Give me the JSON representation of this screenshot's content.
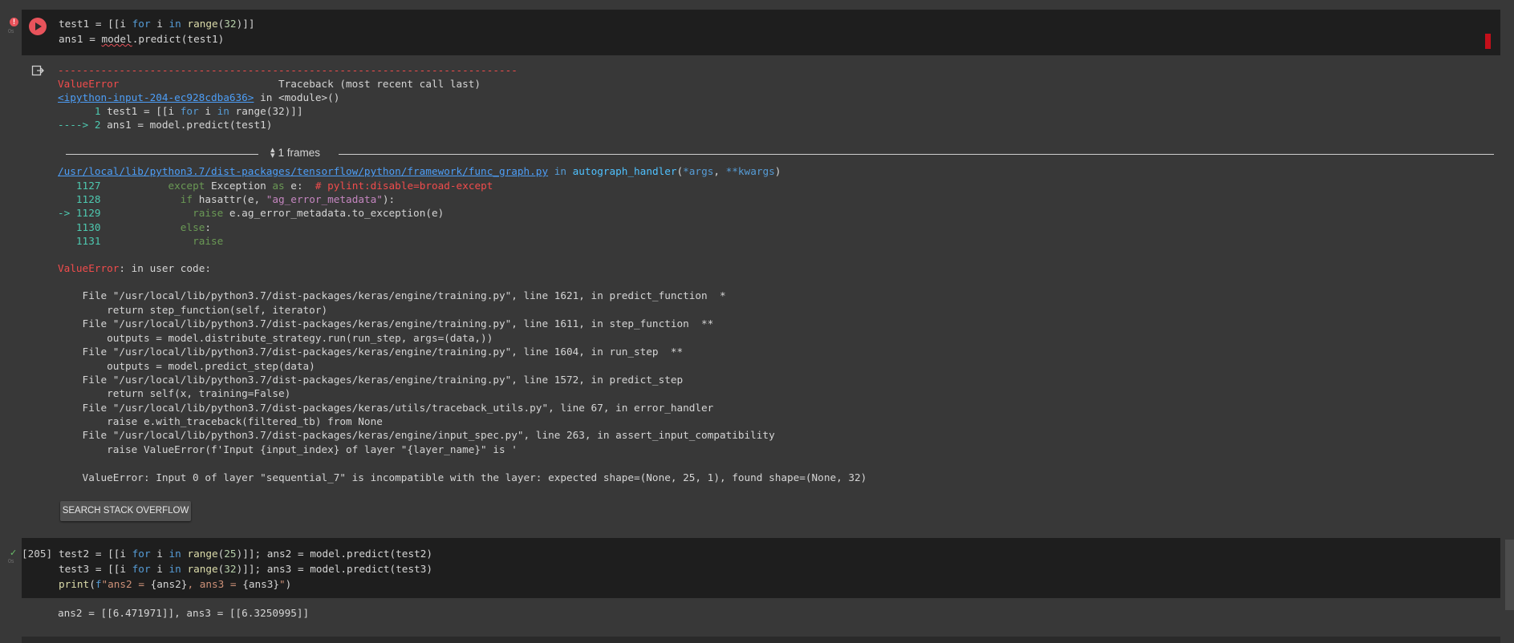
{
  "cell1": {
    "status_icon": "error-icon",
    "run_icon": "run-icon",
    "code_lines": [
      "test1 = [[i for i in range(32)]]",
      "ans1 = model.predict(test1)"
    ]
  },
  "output": {
    "icon": "output-icon",
    "dashes": "---------------------------------------------------------------------------",
    "error_name": "ValueError",
    "traceback_header": "Traceback (most recent call last)",
    "input_link": "<ipython-input-204-ec928cdba636>",
    "in_module": " in <module>()",
    "trace_lines": [
      "      1 test1 = [[i for i in range(32)]]",
      "----> 2 ans1 = model.predict(test1)"
    ],
    "frames_label": "1 frames",
    "func_graph_link": "/usr/local/lib/python3.7/dist-packages/tensorflow/python/framework/func_graph.py",
    "func_graph_in": " in autograph_handler(*args, **kwargs)",
    "src_numbers": [
      "   1127",
      "   1128",
      "-> 1129",
      "   1130",
      "   1131"
    ],
    "src_code": [
      "           except Exception as e:  # pylint:disable=broad-except",
      "             if hasattr(e, \"ag_error_metadata\"):",
      "               raise e.ag_error_metadata.to_exception(e)",
      "             else:",
      "               raise"
    ],
    "user_code_prefix": "ValueError",
    "user_code_suffix": ": in user code:",
    "file_lines": [
      "    File \"/usr/local/lib/python3.7/dist-packages/keras/engine/training.py\", line 1621, in predict_function  *",
      "        return step_function(self, iterator)",
      "    File \"/usr/local/lib/python3.7/dist-packages/keras/engine/training.py\", line 1611, in step_function  **",
      "        outputs = model.distribute_strategy.run(run_step, args=(data,))",
      "    File \"/usr/local/lib/python3.7/dist-packages/keras/engine/training.py\", line 1604, in run_step  **",
      "        outputs = model.predict_step(data)",
      "    File \"/usr/local/lib/python3.7/dist-packages/keras/engine/training.py\", line 1572, in predict_step",
      "        return self(x, training=False)",
      "    File \"/usr/local/lib/python3.7/dist-packages/keras/utils/traceback_utils.py\", line 67, in error_handler",
      "        raise e.with_traceback(filtered_tb) from None",
      "    File \"/usr/local/lib/python3.7/dist-packages/keras/engine/input_spec.py\", line 263, in assert_input_compatibility",
      "        raise ValueError(f'Input {input_index} of layer \"{layer_name}\" is '"
    ],
    "final_error": "    ValueError: Input 0 of layer \"sequential_7\" is incompatible with the layer: expected shape=(None, 25, 1), found shape=(None, 32)",
    "so_button": "SEARCH STACK OVERFLOW"
  },
  "cell2": {
    "status_icon": "check-icon",
    "exec_count": "[205]",
    "code_lines": [
      "test2 = [[i for i in range(25)]]; ans2 = model.predict(test2)",
      "test3 = [[i for i in range(32)]]; ans3 = model.predict(test3)",
      "print(f\"ans2 = {ans2}, ans3 = {ans3}\")"
    ],
    "output": "ans2 = [[6.471971]], ans3 = [[6.3250995]]"
  },
  "gutter_label": "0s"
}
